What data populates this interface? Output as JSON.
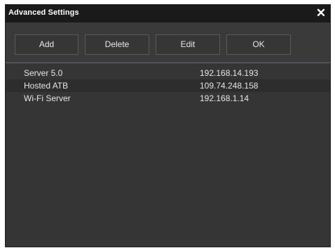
{
  "window": {
    "title": "Advanced Settings",
    "close_glyph": "✕"
  },
  "toolbar": {
    "add_label": "Add",
    "delete_label": "Delete",
    "edit_label": "Edit",
    "ok_label": "OK"
  },
  "servers": [
    {
      "name": "Server 5.0",
      "address": "192.168.14.193"
    },
    {
      "name": "Hosted ATB",
      "address": "109.74.248.158"
    },
    {
      "name": "Wi-Fi Server",
      "address": "192.168.1.14"
    }
  ],
  "colors": {
    "background": "#353535",
    "titlebar": "#1a1a1a",
    "text": "#e6e6e6",
    "alt_row": "#2d2d2d"
  }
}
